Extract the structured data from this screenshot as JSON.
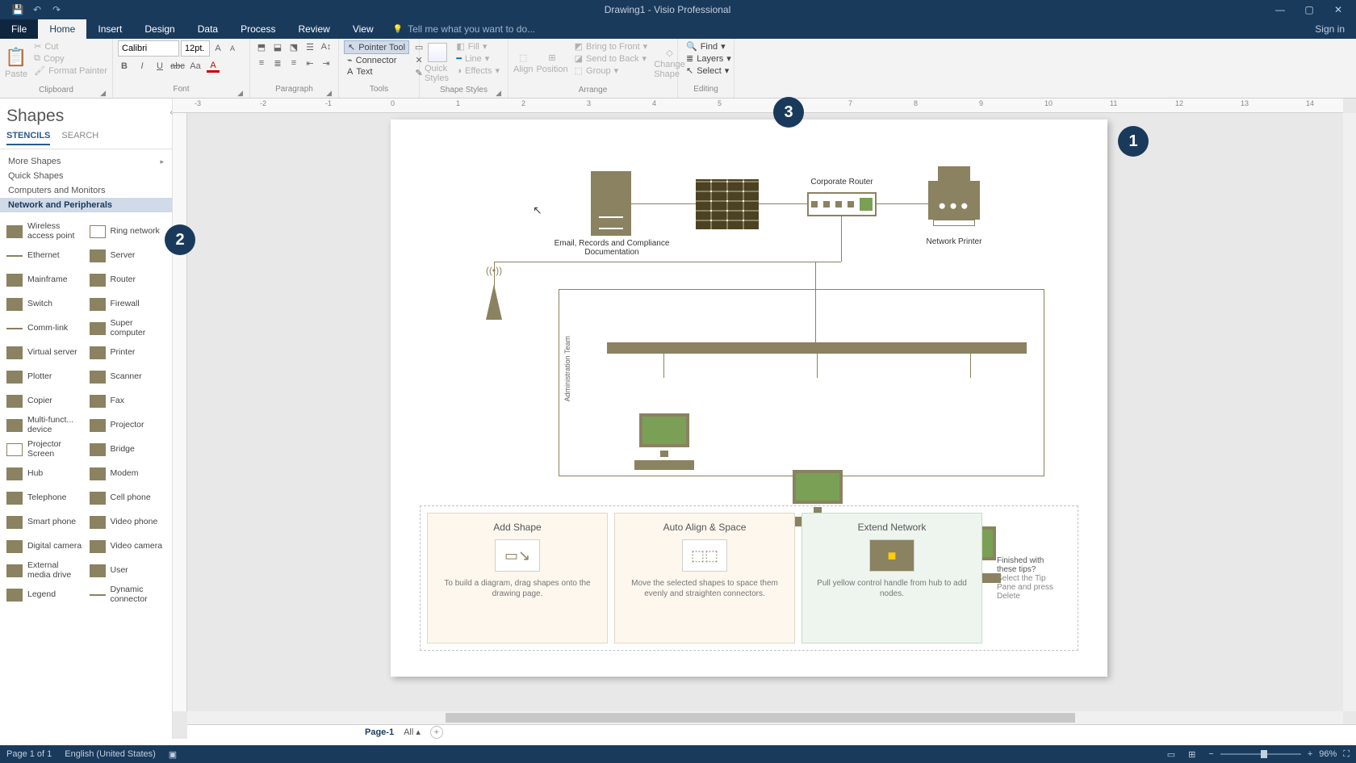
{
  "app": {
    "title": "Drawing1 - Visio Professional",
    "signin": "Sign in"
  },
  "tabs": [
    "File",
    "Home",
    "Insert",
    "Design",
    "Data",
    "Process",
    "Review",
    "View"
  ],
  "active_tab": "Home",
  "tellme": "Tell me what you want to do...",
  "ribbon": {
    "clipboard": {
      "paste": "Paste",
      "cut": "Cut",
      "copy": "Copy",
      "fmt": "Format Painter",
      "label": "Clipboard"
    },
    "font": {
      "name": "Calibri",
      "size": "12pt.",
      "label": "Font"
    },
    "paragraph": {
      "label": "Paragraph"
    },
    "tools": {
      "pointer": "Pointer Tool",
      "connector": "Connector",
      "text": "Text",
      "label": "Tools"
    },
    "shapestyles": {
      "quick": "Quick Styles",
      "fill": "Fill",
      "line": "Line",
      "effects": "Effects",
      "label": "Shape Styles"
    },
    "arrange": {
      "align": "Align",
      "position": "Position",
      "bring": "Bring to Front",
      "send": "Send to Back",
      "group": "Group",
      "change": "Change Shape",
      "label": "Arrange"
    },
    "editing": {
      "find": "Find",
      "layers": "Layers",
      "select": "Select",
      "label": "Editing"
    }
  },
  "shapes": {
    "title": "Shapes",
    "tabs": {
      "stencils": "STENCILS",
      "search": "SEARCH"
    },
    "stencils": [
      "More Shapes",
      "Quick Shapes",
      "Computers and Monitors",
      "Network and Peripherals"
    ],
    "active_stencil": "Network and Peripherals",
    "items": [
      "Wireless access point",
      "Ring network",
      "Ethernet",
      "Server",
      "Mainframe",
      "Router",
      "Switch",
      "Firewall",
      "Comm-link",
      "Super computer",
      "Virtual server",
      "Printer",
      "Plotter",
      "Scanner",
      "Copier",
      "Fax",
      "Multi-funct... device",
      "Projector",
      "Projector Screen",
      "Bridge",
      "Hub",
      "Modem",
      "Telephone",
      "Cell phone",
      "Smart phone",
      "Video phone",
      "Digital camera",
      "Video camera",
      "External media drive",
      "User",
      "Legend",
      "Dynamic connector"
    ]
  },
  "diagram": {
    "server_label": "Email, Records and Compliance Documentation",
    "router_label": "Corporate Router",
    "printer_label": "Network Printer",
    "team_label": "Administration Team"
  },
  "tips": {
    "t1": {
      "title": "Add Shape",
      "body": "To build a diagram, drag shapes onto the drawing page."
    },
    "t2": {
      "title": "Auto Align & Space",
      "body": "Move the selected shapes to space them evenly and straighten connectors."
    },
    "t3": {
      "title": "Extend Network",
      "body": "Pull yellow control handle from hub to add nodes."
    },
    "final_q": "Finished with these tips?",
    "final_a": "Select the Tip Pane and press Delete"
  },
  "pagetabs": {
    "page": "Page-1",
    "all": "All"
  },
  "status": {
    "pages": "Page 1 of 1",
    "lang": "English (United States)",
    "zoom": "96%"
  },
  "badges": {
    "b1": "1",
    "b2": "2",
    "b3": "3"
  }
}
